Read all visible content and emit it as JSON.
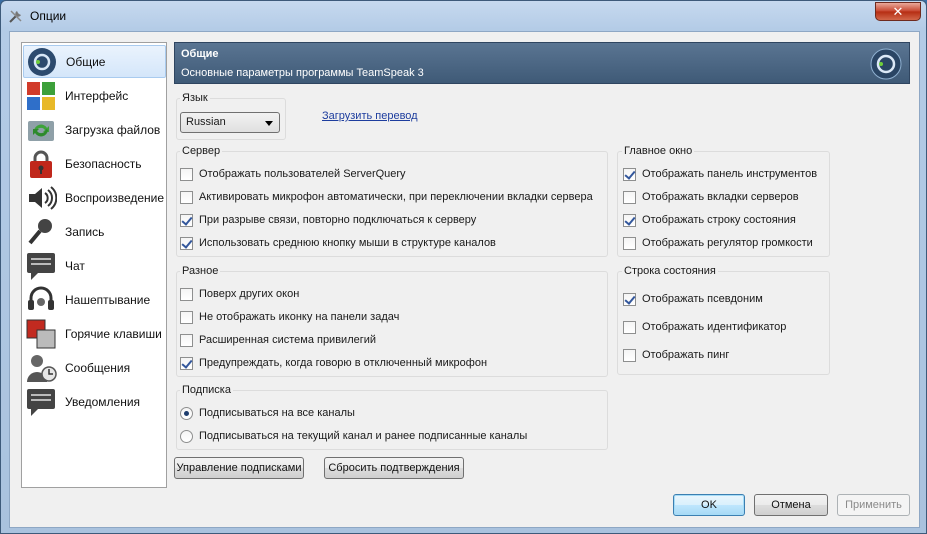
{
  "window": {
    "title": "Опции",
    "close_label": "✕"
  },
  "sidebar": {
    "items": [
      {
        "label": "Общие",
        "icon": "teamspeak-logo-icon",
        "selected": true
      },
      {
        "label": "Интерфейс",
        "icon": "interface-tiles-icon",
        "selected": false
      },
      {
        "label": "Загрузка файлов",
        "icon": "file-transfer-icon",
        "selected": false
      },
      {
        "label": "Безопасность",
        "icon": "security-lock-icon",
        "selected": false
      },
      {
        "label": "Воспроизведение",
        "icon": "speaker-icon",
        "selected": false
      },
      {
        "label": "Запись",
        "icon": "microphone-icon",
        "selected": false
      },
      {
        "label": "Чат",
        "icon": "chat-bubble-icon",
        "selected": false
      },
      {
        "label": "Нашептывание",
        "icon": "headset-icon",
        "selected": false
      },
      {
        "label": "Горячие клавиши",
        "icon": "hotkeys-icon",
        "selected": false
      },
      {
        "label": "Сообщения",
        "icon": "messages-icon",
        "selected": false
      },
      {
        "label": "Уведомления",
        "icon": "notifications-icon",
        "selected": false
      }
    ]
  },
  "header": {
    "title": "Общие",
    "subtitle": "Основные параметры программы TeamSpeak 3"
  },
  "language": {
    "group_title": "Язык",
    "selected": "Russian",
    "download_link": "Загрузить перевод"
  },
  "server": {
    "group_title": "Сервер",
    "options": [
      {
        "label": "Отображать пользователей ServerQuery",
        "checked": false
      },
      {
        "label": "Активировать микрофон автоматически, при переключении вкладки сервера",
        "checked": false
      },
      {
        "label": "При разрыве связи, повторно подключаться к серверу",
        "checked": true
      },
      {
        "label": "Использовать среднюю кнопку мыши в структуре каналов",
        "checked": true
      }
    ]
  },
  "main_window": {
    "group_title": "Главное окно",
    "options": [
      {
        "label": "Отображать панель инструментов",
        "checked": true
      },
      {
        "label": "Отображать вкладки серверов",
        "checked": false
      },
      {
        "label": "Отображать строку состояния",
        "checked": true
      },
      {
        "label": "Отображать регулятор громкости",
        "checked": false
      }
    ]
  },
  "misc": {
    "group_title": "Разное",
    "options": [
      {
        "label": "Поверх других окон",
        "checked": false
      },
      {
        "label": "Не отображать иконку на панели задач",
        "checked": false
      },
      {
        "label": "Расширенная система привилегий",
        "checked": false
      },
      {
        "label": "Предупреждать, когда говорю в отключенный микрофон",
        "checked": true
      }
    ]
  },
  "status_bar": {
    "group_title": "Строка состояния",
    "options": [
      {
        "label": "Отображать псевдоним",
        "checked": true
      },
      {
        "label": "Отображать идентификатор",
        "checked": false
      },
      {
        "label": "Отображать пинг",
        "checked": false
      }
    ]
  },
  "subscription": {
    "group_title": "Подписка",
    "options": [
      {
        "label": "Подписываться на все каналы",
        "checked": true
      },
      {
        "label": "Подписываться на текущий канал и ранее подписанные каналы",
        "checked": false
      }
    ]
  },
  "buttons": {
    "manage_subscriptions": "Управление подписками",
    "reset_confirmations": "Сбросить подтверждения",
    "ok": "OK",
    "cancel": "Отмена",
    "apply": "Применить"
  },
  "colors": {
    "header_bg": "#4a6684",
    "accent": "#33579c",
    "close_button": "#c6432c"
  }
}
